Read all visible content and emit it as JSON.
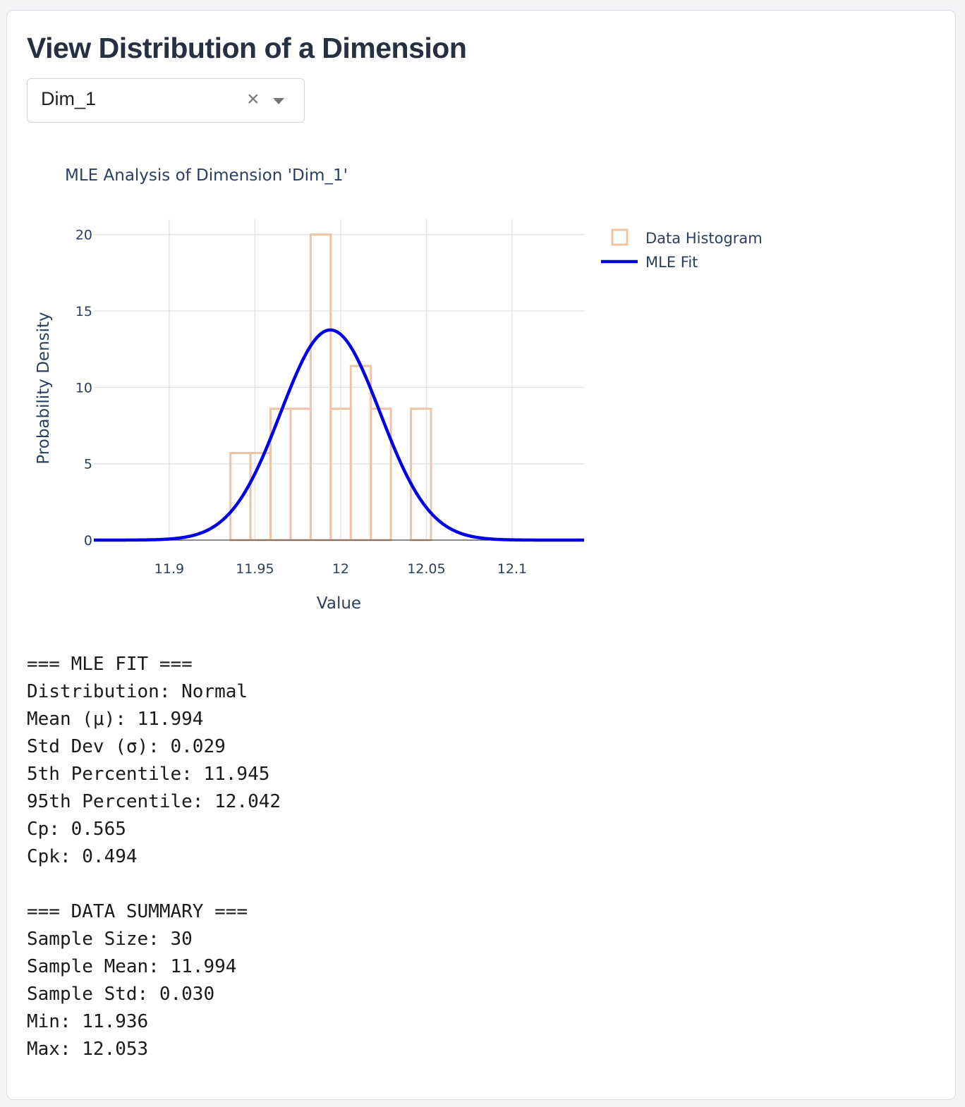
{
  "page": {
    "title": "View Distribution of a Dimension"
  },
  "dropdown": {
    "selected": "Dim_1",
    "clear_symbol": "×"
  },
  "chart_data": {
    "type": "bar",
    "title": "MLE Analysis of Dimension 'Dim_1'",
    "xlabel": "Value",
    "ylabel": "Probability Density",
    "xlim": [
      11.856,
      12.142
    ],
    "ylim": [
      0,
      21
    ],
    "x_ticks": [
      11.9,
      11.95,
      12,
      12.05,
      12.1
    ],
    "x_tick_labels": [
      "11.9",
      "11.95",
      "12",
      "12.05",
      "12.1"
    ],
    "y_ticks": [
      0,
      5,
      10,
      15,
      20
    ],
    "y_tick_labels": [
      "0",
      "5",
      "10",
      "15",
      "20"
    ],
    "grid": true,
    "legend_position": "top-right",
    "series": [
      {
        "name": "Data Histogram",
        "kind": "histogram",
        "color": "#f0c3a6",
        "bin_width": 0.0117,
        "bin_starts": [
          11.9357,
          11.9474,
          11.9591,
          11.9708,
          11.9825,
          11.9942,
          12.0059,
          12.0176,
          12.0293,
          12.041
        ],
        "values": [
          5.7,
          5.7,
          8.6,
          8.6,
          20.0,
          8.6,
          11.4,
          8.6,
          0,
          8.6
        ]
      },
      {
        "name": "MLE Fit",
        "kind": "normal_pdf",
        "color": "#0000e6",
        "mean": 11.994,
        "std": 0.029
      }
    ]
  },
  "stats": {
    "lines": [
      "=== MLE FIT ===",
      "Distribution: Normal",
      "Mean (μ): 11.994",
      "Std Dev (σ): 0.029",
      "5th Percentile: 11.945",
      "95th Percentile: 12.042",
      "Cp: 0.565",
      "Cpk: 0.494",
      "",
      "=== DATA SUMMARY ===",
      "Sample Size: 30",
      "Sample Mean: 11.994",
      "Sample Std: 0.030",
      "Min: 11.936",
      "Max: 12.053"
    ]
  }
}
